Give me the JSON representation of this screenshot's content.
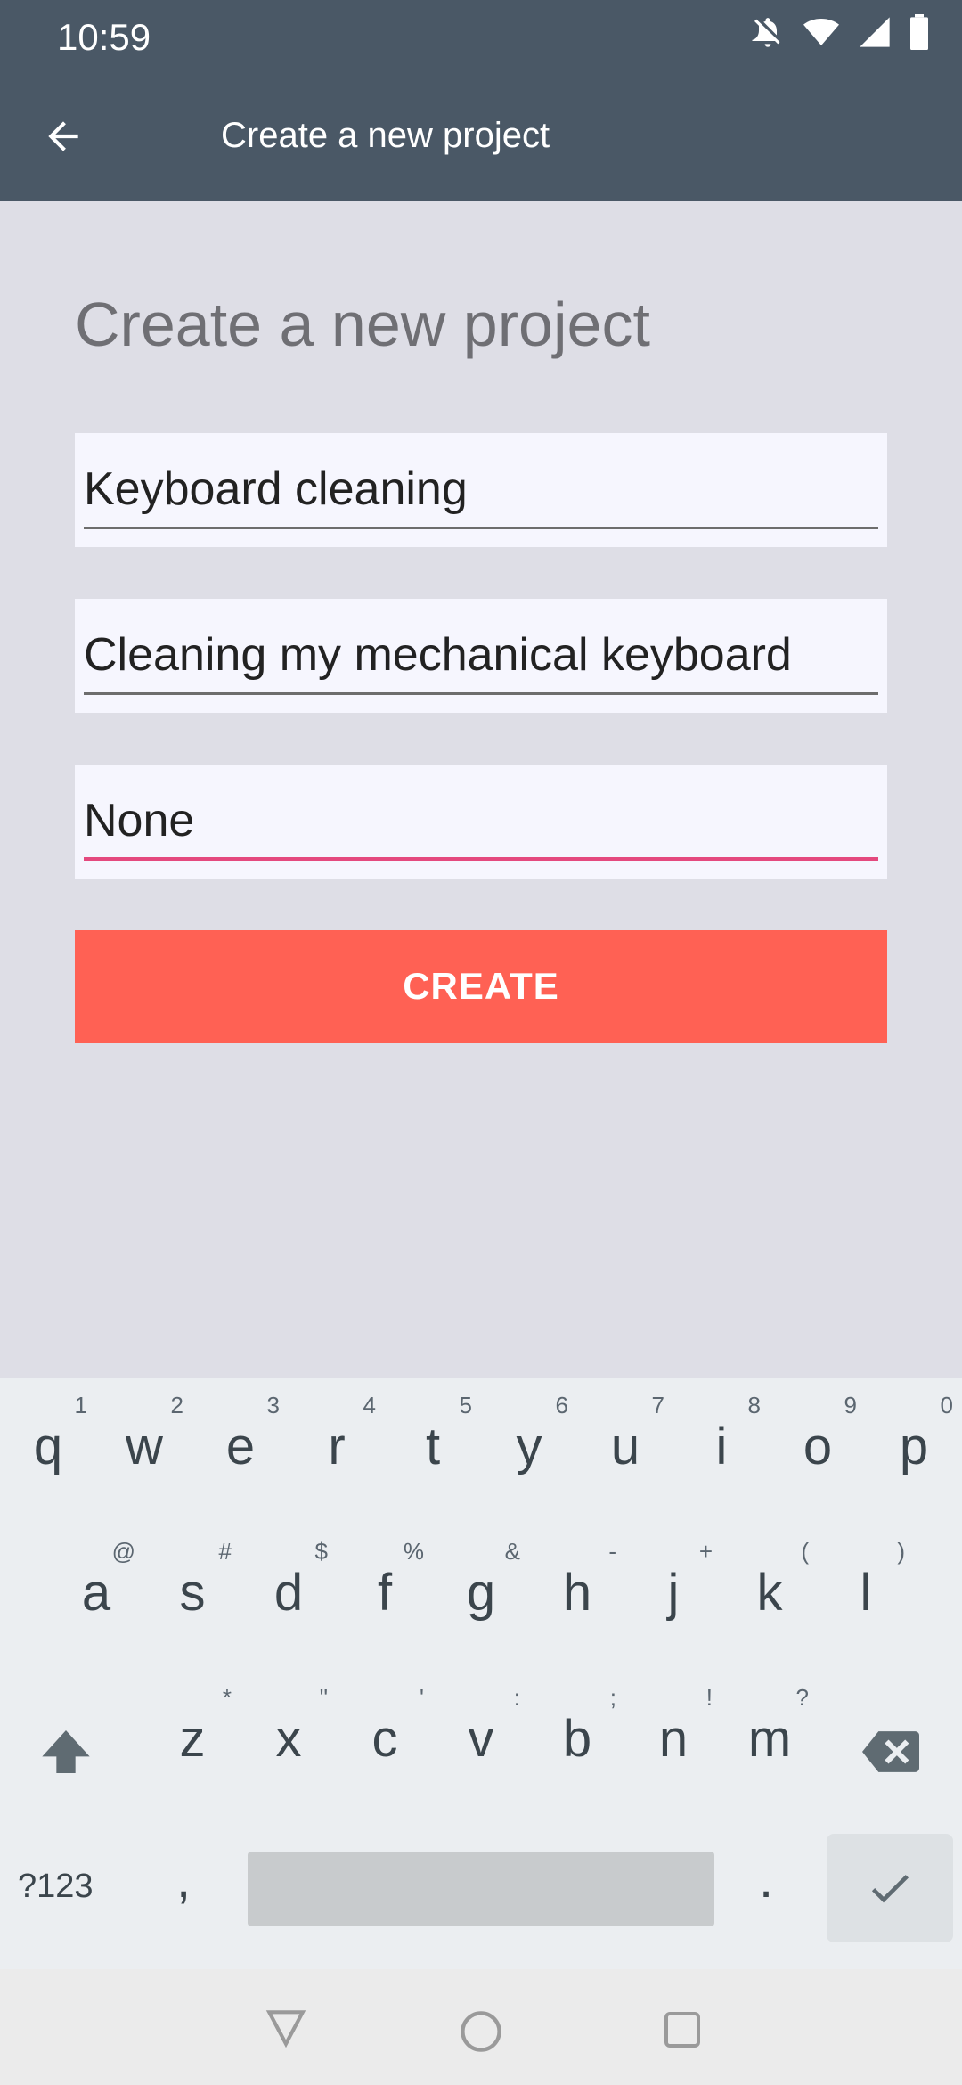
{
  "status_bar": {
    "time": "10:59",
    "icons": [
      "notifications-off-icon",
      "wifi-icon",
      "signal-icon",
      "battery-icon"
    ]
  },
  "app_bar": {
    "title": "Create a new project",
    "back_icon": "arrow-back-icon"
  },
  "form": {
    "heading": "Create a new project",
    "name_value": "Keyboard cleaning",
    "description_value": "Cleaning my mechanical keyboard",
    "parent_value": "None",
    "create_label": "CREATE"
  },
  "keyboard": {
    "row1": [
      {
        "letter": "q",
        "hint": "1"
      },
      {
        "letter": "w",
        "hint": "2"
      },
      {
        "letter": "e",
        "hint": "3"
      },
      {
        "letter": "r",
        "hint": "4"
      },
      {
        "letter": "t",
        "hint": "5"
      },
      {
        "letter": "y",
        "hint": "6"
      },
      {
        "letter": "u",
        "hint": "7"
      },
      {
        "letter": "i",
        "hint": "8"
      },
      {
        "letter": "o",
        "hint": "9"
      },
      {
        "letter": "p",
        "hint": "0"
      }
    ],
    "row2": [
      {
        "letter": "a",
        "hint": "@"
      },
      {
        "letter": "s",
        "hint": "#"
      },
      {
        "letter": "d",
        "hint": "$"
      },
      {
        "letter": "f",
        "hint": "%"
      },
      {
        "letter": "g",
        "hint": "&"
      },
      {
        "letter": "h",
        "hint": "-"
      },
      {
        "letter": "j",
        "hint": "+"
      },
      {
        "letter": "k",
        "hint": "("
      },
      {
        "letter": "l",
        "hint": ")"
      }
    ],
    "row3": [
      {
        "letter": "z",
        "hint": "*"
      },
      {
        "letter": "x",
        "hint": "\""
      },
      {
        "letter": "c",
        "hint": "'"
      },
      {
        "letter": "v",
        "hint": ":"
      },
      {
        "letter": "b",
        "hint": ";"
      },
      {
        "letter": "n",
        "hint": "!"
      },
      {
        "letter": "m",
        "hint": "?"
      }
    ],
    "symbols_label": "?123",
    "comma": ",",
    "period": "."
  },
  "colors": {
    "app_bar": "#4a5866",
    "background": "#dedee6",
    "button": "#ff6154",
    "focus_underline": "#e4497e"
  }
}
